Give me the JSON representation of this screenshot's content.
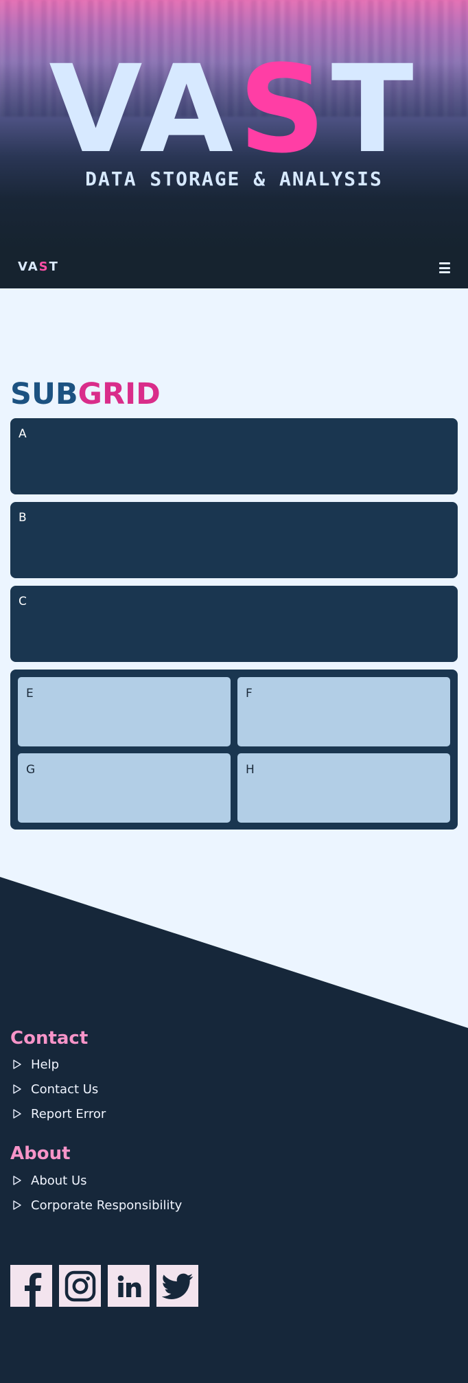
{
  "hero": {
    "title_part1": "VA",
    "title_accent": "S",
    "title_part2": "T",
    "subtitle": "DATA STORAGE & ANALYSIS"
  },
  "nav": {
    "logo_part1": "VA",
    "logo_accent": "S",
    "logo_part2": "T",
    "menu_icon": "hamburger-menu-icon"
  },
  "subgrid": {
    "title_part1": "SUB",
    "title_part2": "GRID",
    "cards": [
      "A",
      "B",
      "C"
    ],
    "inner_cells": [
      "E",
      "F",
      "G",
      "H"
    ]
  },
  "footer": {
    "contact": {
      "heading": "Contact",
      "links": [
        "Help",
        "Contact Us",
        "Report Error"
      ]
    },
    "about": {
      "heading": "About",
      "links": [
        "About Us",
        "Corporate Responsibility"
      ]
    },
    "social": [
      "facebook-icon",
      "instagram-icon",
      "linkedin-icon",
      "twitter-icon"
    ]
  },
  "colors": {
    "accent_pink": "#ff3ea5",
    "title_blue": "#1c5281",
    "title_pink": "#d92d8a",
    "card_dark": "#1a3650",
    "cell_light": "#b2cee6",
    "footer_bg": "#16273a",
    "footer_heading": "#f794c8",
    "page_bg": "#ecf5ff"
  }
}
